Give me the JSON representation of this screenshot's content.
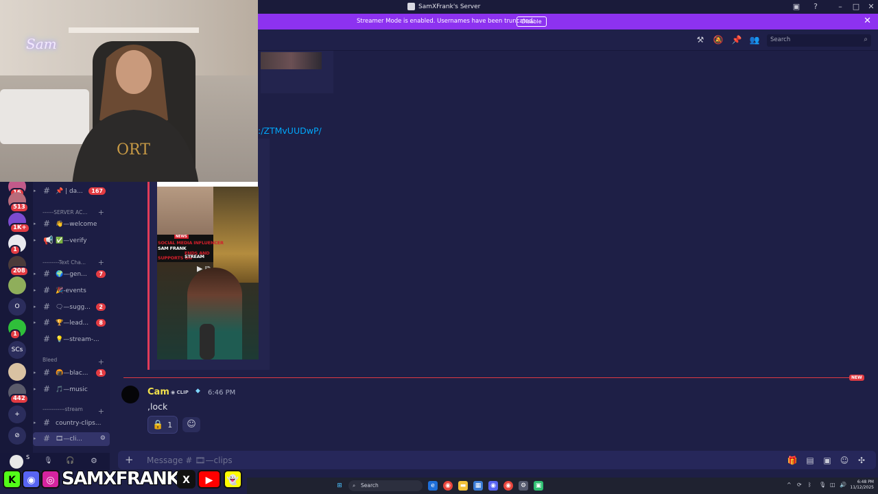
{
  "window": {
    "title": "SamXFrank's Server",
    "controls": [
      "minimize",
      "maximize",
      "close"
    ]
  },
  "banner": {
    "message": "Streamer Mode is enabled. Usernames have been truncated.",
    "disable_label": "Disable",
    "close_glyph": "✕"
  },
  "header": {
    "icons": [
      "threads-icon",
      "notification-bell-off-icon",
      "pin-icon",
      "member-list-icon"
    ],
    "search_placeholder": "Search"
  },
  "webcam": {
    "neon_sign": "Sam"
  },
  "servers": [
    {
      "badge": "16",
      "color": "#c25a8a"
    },
    {
      "badge": "513",
      "color": "#b96b7a"
    },
    {
      "badge": "1K+",
      "color": "#7c4bcf"
    },
    {
      "badge": "1",
      "color": "#e9e9ee"
    },
    {
      "badge": "208",
      "color": "#4a3b3a"
    },
    {
      "badge": "",
      "color": "#8fae5b"
    },
    {
      "label": "O",
      "badge": "",
      "color": "#2b2d5c"
    },
    {
      "badge": "1",
      "color": "#2fbf3a"
    },
    {
      "label": "SCs",
      "badge": "",
      "color": "#2b2d5c"
    },
    {
      "badge": "",
      "color": "#d9c2a2"
    },
    {
      "badge": "442",
      "color": "#5b5b6b"
    },
    {
      "label": "+",
      "badge": "",
      "color": "#2b2d5c"
    },
    {
      "label": "⊘",
      "badge": "",
      "color": "#2b2d5c"
    }
  ],
  "channels": {
    "items": [
      {
        "name": "📌 | da...",
        "count": "167"
      },
      {
        "name": "👋—welcome",
        "count": ""
      },
      {
        "name": "✅—verify",
        "count": ""
      },
      {
        "name": "🌍—gen...",
        "count": "7"
      },
      {
        "name": "🎉-events",
        "count": ""
      },
      {
        "name": "🗨—sugg...",
        "count": "2"
      },
      {
        "name": "🏆—lead...",
        "count": "8"
      },
      {
        "name": "💡—stream-...",
        "count": ""
      },
      {
        "name": "🍘—blac...",
        "count": "1"
      },
      {
        "name": "🎵—music",
        "count": ""
      },
      {
        "name": "country-clips...",
        "count": ""
      },
      {
        "name": "🎞—cli...",
        "count": ""
      }
    ],
    "categories": {
      "server": "------SERVER AC...",
      "text": "---------Text Cha...",
      "bleed": "Bleed",
      "stream": "------------stream"
    }
  },
  "user_panel": {
    "name": "S"
  },
  "messages": {
    "link_text": ":/ZTMvUUDwP/",
    "video": {
      "tag": "NEWS",
      "line1": "SOCIAL MEDIA INFLUENCER",
      "line2": "SAM FRANK",
      "line3": "ENDS AND",
      "line4": "SUPPORTS ON",
      "line5": "STREAM"
    },
    "new_label": "NEW",
    "author": "Cam",
    "author_tag": "CLIP",
    "timestamp": "6:46 PM",
    "text": ",lock",
    "reaction_emoji": "🔒",
    "reaction_count": "1"
  },
  "composer": {
    "placeholder": "Message # 🎞—clips"
  },
  "social": {
    "handle": "SAMXFRANK",
    "icons": [
      "kick-icon",
      "discord-icon",
      "instagram-icon",
      "x-icon",
      "youtube-icon",
      "snapchat-icon"
    ]
  },
  "taskbar": {
    "search_placeholder": "Search",
    "time": "6:48 PM",
    "date": "11/12/2025"
  },
  "colors": {
    "accent": "#8d32f0",
    "background": "#1e1f46",
    "unread": "#e23b42",
    "author": "#f2e14c",
    "link": "#00a8fc"
  }
}
